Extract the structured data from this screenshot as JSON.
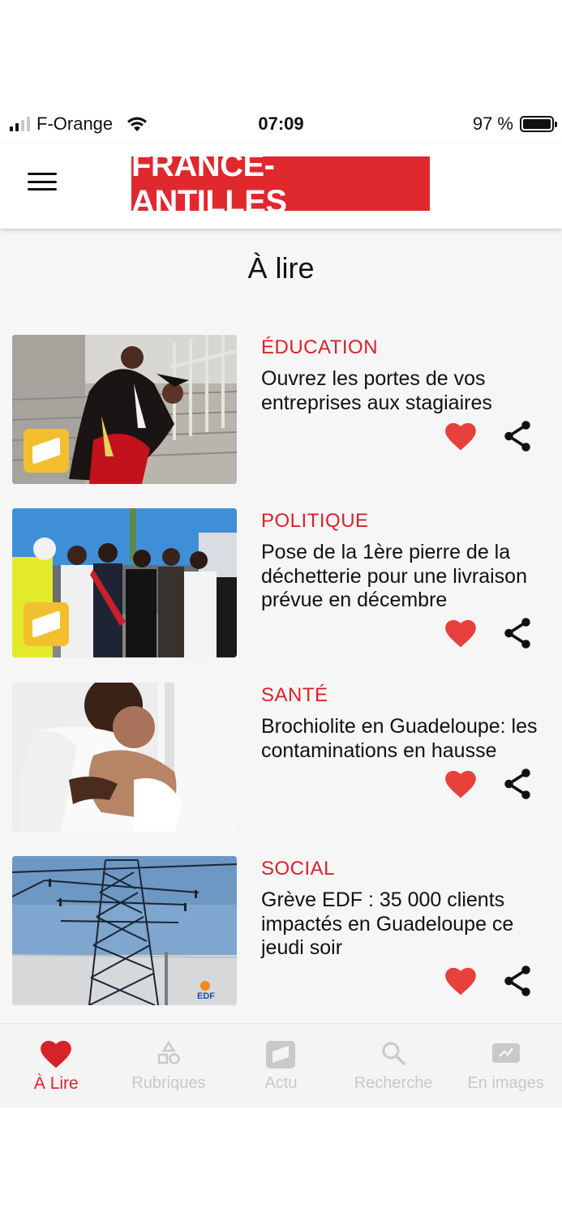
{
  "status_bar": {
    "carrier": "F-Orange",
    "time": "07:09",
    "battery": "97 %"
  },
  "header": {
    "logo_text": "FRANCE-ANTILLES",
    "menu_icon": "hamburger-icon"
  },
  "page": {
    "title": "À lire"
  },
  "articles": [
    {
      "category": "ÉDUCATION",
      "title": "Ouvrez les portes de vos entreprises  aux stagiaires",
      "has_badge": true
    },
    {
      "category": "POLITIQUE",
      "title": " Pose de la 1ère pierre de la déchetterie pour une livraison prévue en décembre",
      "has_badge": true
    },
    {
      "category": "SANTÉ",
      "title": "Brochiolite en Guadeloupe: les contaminations en hausse",
      "has_badge": false
    },
    {
      "category": "SOCIAL",
      "title": "Grève EDF : 35 000 clients impactés en Guadeloupe ce jeudi soir",
      "has_badge": false
    }
  ],
  "thumbnail_text": {
    "edf": "EDF"
  },
  "tab_bar": {
    "tabs": [
      {
        "label": "À Lire",
        "icon": "heart-icon",
        "active": true
      },
      {
        "label": "Rubriques",
        "icon": "shapes-icon",
        "active": false
      },
      {
        "label": "Actu",
        "icon": "news-icon",
        "active": false
      },
      {
        "label": "Recherche",
        "icon": "search-icon",
        "active": false
      },
      {
        "label": "En images",
        "icon": "video-camera-icon",
        "active": false
      }
    ]
  },
  "colors": {
    "brand_red": "#e0282f",
    "category_red": "#d6232a",
    "heart_red": "#e8403c",
    "badge_yellow": "#f2c02f",
    "inactive_tab": "#c9c9c9"
  }
}
